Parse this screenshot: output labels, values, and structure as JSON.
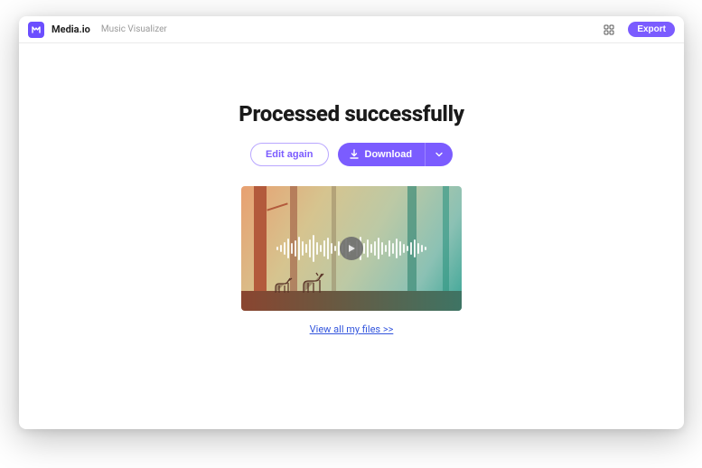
{
  "header": {
    "brand": "Media.io",
    "subtitle": "Music Visualizer",
    "export_label": "Export"
  },
  "main": {
    "title": "Processed successfully",
    "edit_label": "Edit again",
    "download_label": "Download",
    "view_files_label": "View all my files >>"
  },
  "colors": {
    "accent": "#7b5cff"
  },
  "icons": {
    "logo": "m",
    "grid": "grid-icon",
    "download": "download-icon",
    "caret": "chevron-down-icon",
    "play": "play-icon"
  }
}
